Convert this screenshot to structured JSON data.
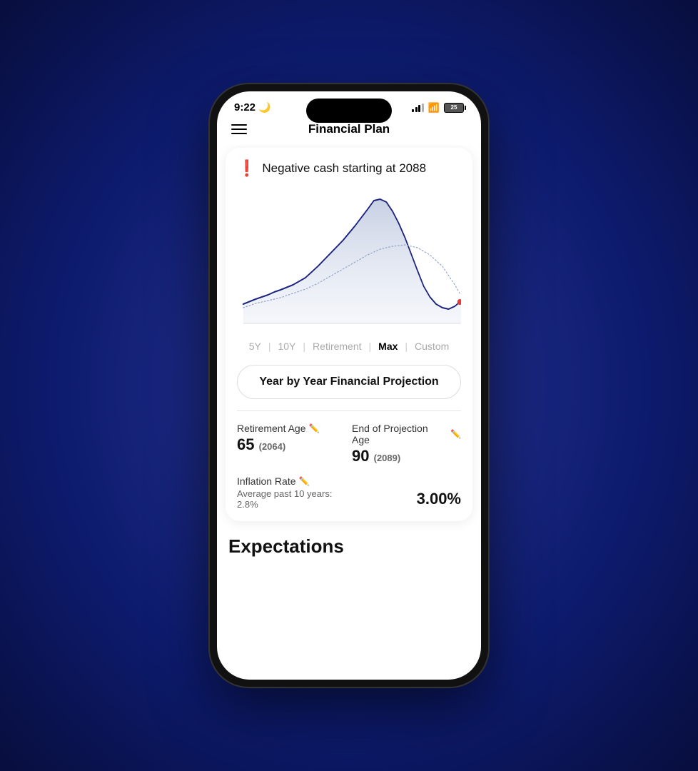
{
  "statusBar": {
    "time": "9:22",
    "moonIcon": "🌙",
    "batteryLevel": "25"
  },
  "navBar": {
    "title": "Financial Plan",
    "menuIcon": "menu"
  },
  "alert": {
    "icon": "❗",
    "text": "Negative cash starting at 2088"
  },
  "chart": {
    "ariaLabel": "Financial projection chart showing growth then decline"
  },
  "timeRange": {
    "options": [
      "5Y",
      "10Y",
      "Retirement",
      "Max",
      "Custom"
    ],
    "active": "Max",
    "dividers": [
      "|",
      "|",
      "|",
      "|"
    ]
  },
  "projectionButton": {
    "label": "Year by Year Financial Projection"
  },
  "details": {
    "retirementAge": {
      "label": "Retirement Age",
      "value": "65",
      "sub": "(2064)"
    },
    "endProjectionAge": {
      "label": "End of Projection Age",
      "value": "90",
      "sub": "(2089)"
    },
    "inflationRate": {
      "label": "Inflation Rate",
      "subLabel": "Average past 10 years: 2.8%",
      "value": "3.00%"
    }
  },
  "expectations": {
    "title": "Expectations"
  }
}
